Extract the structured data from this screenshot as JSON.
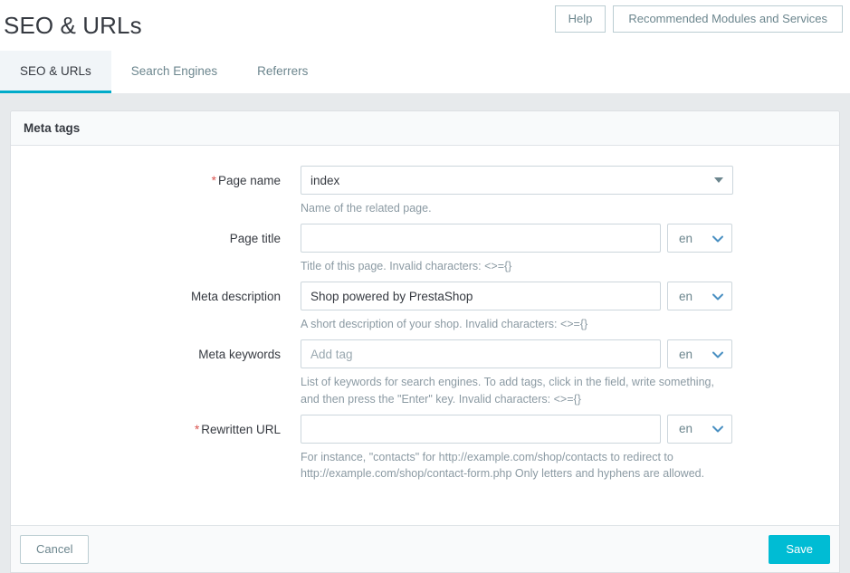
{
  "header": {
    "title": "SEO & URLs",
    "help_button": "Help",
    "recommended_button": "Recommended Modules and Services"
  },
  "tabs": [
    {
      "label": "SEO & URLs",
      "active": true
    },
    {
      "label": "Search Engines",
      "active": false
    },
    {
      "label": "Referrers",
      "active": false
    }
  ],
  "panel": {
    "title": "Meta tags"
  },
  "form": {
    "page_name": {
      "label": "Page name",
      "required": true,
      "value": "index",
      "help": "Name of the related page."
    },
    "page_title": {
      "label": "Page title",
      "required": false,
      "value": "",
      "placeholder": "",
      "lang": "en",
      "help": "Title of this page. Invalid characters: <>={}"
    },
    "meta_description": {
      "label": "Meta description",
      "required": false,
      "value": "Shop powered by PrestaShop",
      "placeholder": "",
      "lang": "en",
      "help": "A short description of your shop. Invalid characters: <>={}"
    },
    "meta_keywords": {
      "label": "Meta keywords",
      "required": false,
      "value": "",
      "placeholder": "Add tag",
      "lang": "en",
      "help": "List of keywords for search engines. To add tags, click in the field, write something, and then press the \"Enter\" key. Invalid characters: <>={}"
    },
    "rewritten_url": {
      "label": "Rewritten URL",
      "required": true,
      "value": "",
      "placeholder": "",
      "lang": "en",
      "help": "For instance, \"contacts\" for http://example.com/shop/contacts to redirect to http://example.com/shop/contact-form.php Only letters and hyphens are allowed."
    }
  },
  "footer": {
    "cancel_label": "Cancel",
    "save_label": "Save"
  },
  "colors": {
    "accent": "#00bcd4",
    "tab_underline": "#00abc9",
    "required_star": "#d9534f",
    "page_background": "#e7eaec"
  },
  "icons": {
    "select_caret": "caret-down-icon",
    "language_chevron": "chevron-down-icon"
  }
}
